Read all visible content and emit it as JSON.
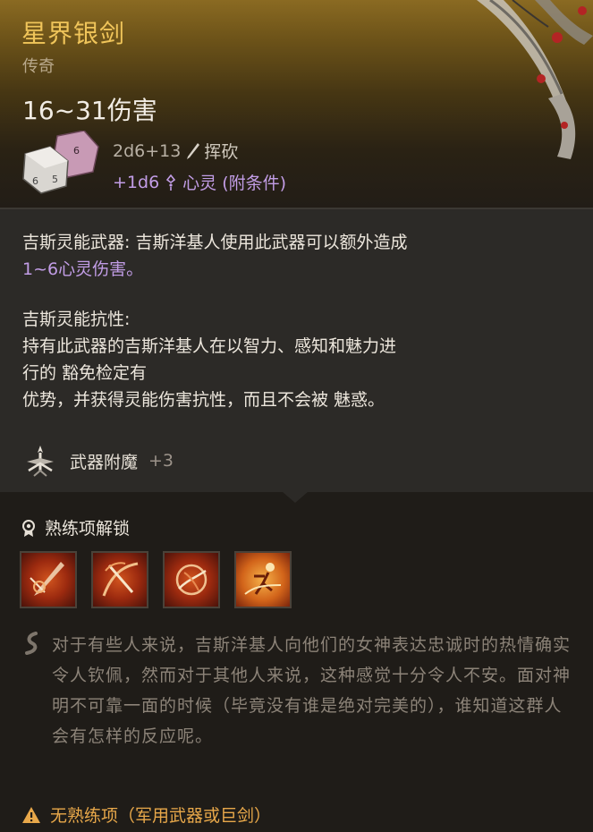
{
  "item": {
    "name": "星界银剑",
    "rarity": "传奇",
    "damage_range": "16~31伤害",
    "damage_formula": "2d6+13",
    "damage_type": "挥砍",
    "bonus_damage": "+1d6",
    "bonus_type": "心灵 (附条件)"
  },
  "properties": [
    {
      "title": "吉斯灵能武器:",
      "lines": [
        "吉斯洋基人使用此武器可以额外造成"
      ],
      "highlight": "1~6心灵伤害。"
    },
    {
      "title": "吉斯灵能抗性:",
      "lines": [
        "持有此武器的吉斯洋基人在以智力、感知和魅力进",
        "行的 豁免检定有",
        "优势，并获得灵能伤害抗性，而且不会被 魅惑。"
      ]
    }
  ],
  "enchantment": {
    "label": "武器附魔",
    "value": "+3"
  },
  "proficiency": {
    "title": "熟练项解锁",
    "actions": [
      "action-slash",
      "action-cleave",
      "action-flourish",
      "action-lacerate"
    ]
  },
  "flavor_text": "对于有些人来说，吉斯洋基人向他们的女神表达忠诚时的热情确实令人钦佩，然而对于其他人来说，这种感觉十分令人不安。面对神明不可靠一面的时候（毕竟没有谁是绝对完美的），谁知道这群人会有怎样的反应呢。",
  "warning": "无熟练项（军用武器或巨剑）",
  "colors": {
    "name": "#f0c55a",
    "psychic": "#c29de6",
    "warning": "#e8a84a",
    "flavor": "#8c8378"
  }
}
